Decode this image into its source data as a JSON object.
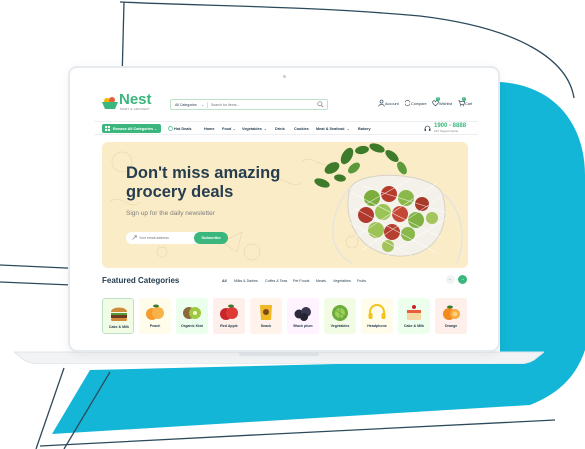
{
  "colors": {
    "brand": "#3bb77e",
    "accent_blue": "#13b6d6",
    "text_dark": "#253d4e",
    "banner_bg": "#fbecc8"
  },
  "header": {
    "logo_text": "Nest",
    "logo_sub": "MART & GROCERY",
    "search": {
      "category": "All Categories",
      "placeholder": "Search for items..."
    },
    "actions": {
      "account": "Account",
      "compare": "Compare",
      "wishlist": "Wishlist",
      "cart": "Cart"
    },
    "wishlist_count": "6",
    "cart_count": "2"
  },
  "nav": {
    "browse_label": "Browse All Categories",
    "items": [
      "Hot Deals",
      "Home",
      "Food",
      "Vegetables",
      "Drink",
      "Cookies",
      "Meat & Seafood",
      "Bakery"
    ],
    "phone": "1900 - 8888",
    "phone_sub": "24/7 Support Center"
  },
  "hero": {
    "title": "Don't miss amazing grocery deals",
    "subtitle": "Sign up for the daily newsletter",
    "email_placeholder": "Your email address",
    "subscribe_label": "Subscribe"
  },
  "featured": {
    "title": "Featured Categories",
    "tabs": [
      "All",
      "Milks & Dairies",
      "Coffes & Teas",
      "Pet Foods",
      "Meats",
      "Vegetables",
      "Fruits"
    ],
    "categories": [
      "Cake & Milk",
      "Peach",
      "Organic Kiwi",
      "Red Apple",
      "Snack",
      "Black plum",
      "Vegetables",
      "Headphone",
      "Cake & Milk",
      "Orange"
    ]
  }
}
